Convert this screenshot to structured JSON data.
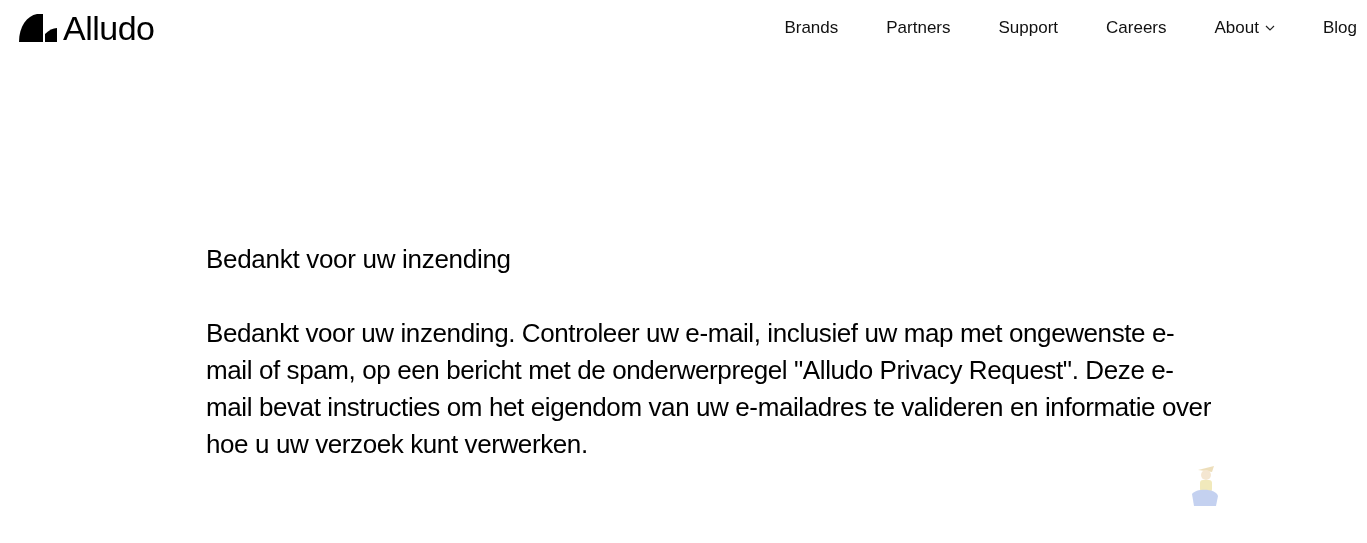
{
  "header": {
    "logo": "Alludo",
    "nav": [
      {
        "label": "Brands",
        "kind": "link"
      },
      {
        "label": "Partners",
        "kind": "link"
      },
      {
        "label": "Support",
        "kind": "link"
      },
      {
        "label": "Careers",
        "kind": "link"
      },
      {
        "label": "About",
        "kind": "dropdown"
      },
      {
        "label": "Blog",
        "kind": "link"
      }
    ]
  },
  "content": {
    "heading": "Bedankt voor uw inzending",
    "message": "Bedankt voor uw inzending. Controleer uw e-mail, inclusief uw map met ongewenste e-mail of spam, op een bericht met de onderwerpregel \"Alludo Privacy Request\". Deze e-mail bevat instructies om het eigendom van uw e-mailadres te valideren en informatie over hoe u uw verzoek kunt verwerken."
  }
}
